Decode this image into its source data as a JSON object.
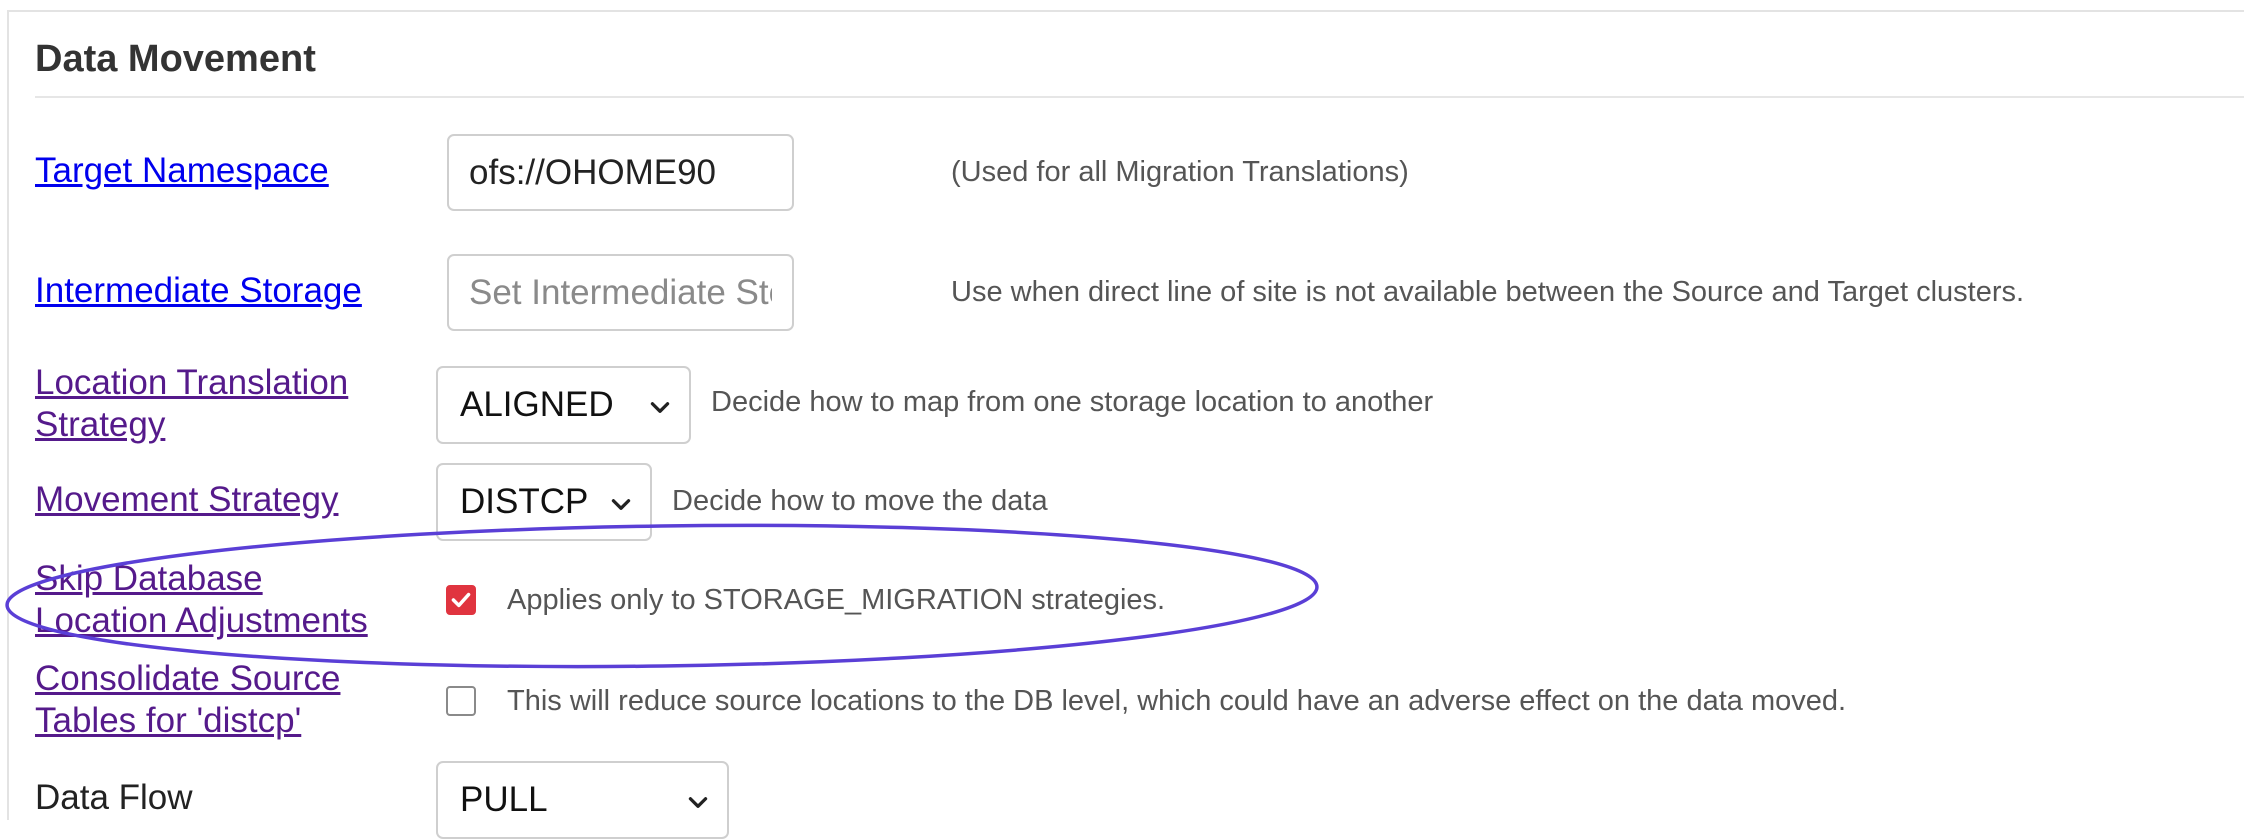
{
  "section": {
    "title": "Data Movement"
  },
  "target_namespace": {
    "label": "Target Namespace",
    "value": "ofs://OHOME90",
    "help": "(Used for all Migration Translations)"
  },
  "intermediate_storage": {
    "label": "Intermediate Storage",
    "placeholder": "Set Intermediate Storage",
    "value": "",
    "help": "Use when direct line of site is not available between the Source and Target clusters."
  },
  "location_translation_strategy": {
    "label_line1": "Location Translation",
    "label_line2": "Strategy",
    "selected": "ALIGNED",
    "help": "Decide how to map from one storage location to another"
  },
  "movement_strategy": {
    "label": "Movement Strategy",
    "selected": "DISTCP",
    "help": "Decide how to move the data"
  },
  "skip_database_location_adjustments": {
    "label_line1": "Skip Database",
    "label_line2": "Location Adjustments",
    "checked": true,
    "help": "Applies only to STORAGE_MIGRATION strategies."
  },
  "consolidate_source_tables": {
    "label_line1": "Consolidate Source",
    "label_line2": "Tables for 'distcp'",
    "checked": false,
    "help": "This will reduce source locations to the DB level, which could have an adverse effect on the data moved."
  },
  "data_flow": {
    "label": "Data Flow",
    "selected": "PULL"
  },
  "colors": {
    "link": "#0000ee",
    "visited_link": "#551a8b",
    "checkbox_checked": "#e0343f",
    "annotation_ellipse": "#5a3fd6"
  }
}
